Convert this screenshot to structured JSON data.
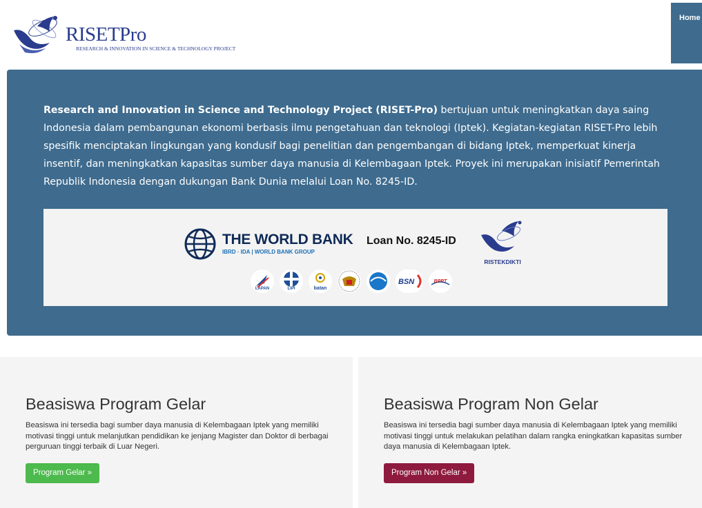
{
  "header": {
    "logo_title": "RISETPro",
    "logo_subtitle": "RESEARCH & INNOVATION IN SCIENCE & TECHNOLOGY PROJECT",
    "nav_home": "Home"
  },
  "hero": {
    "intro_bold": "Research and Innovation in Science and Technology Project (RISET-Pro)",
    "intro_rest": " bertujuan untuk meningkatkan daya saing Indonesia dalam pembangunan ekonomi berbasis ilmu pengetahuan dan teknologi (Iptek). Kegiatan-kegiatan RISET-Pro lebih spesifik menciptakan lingkungan yang kondusif bagi penelitian dan pengembangan di bidang Iptek, memperkuat kinerja insentif, dan meningkatkan kapasitas sumber daya manusia di Kelembagaan Iptek. Proyek ini merupakan inisiatif Pemerintah Republik Indonesia dengan dukungan Bank Dunia melalui Loan No. 8245-ID.",
    "banner": {
      "worldbank_title": "THE WORLD BANK",
      "worldbank_sub": "IBRD · IDA | WORLD BANK GROUP",
      "loan": "Loan No. 8245-ID",
      "ristek_label": "RISTEKDIKTI",
      "agency_logos": [
        {
          "name": "lapan",
          "caption": "LAPAN"
        },
        {
          "name": "lipi",
          "caption": "LIPI"
        },
        {
          "name": "batan",
          "caption": "batan"
        },
        {
          "name": "garuda",
          "caption": ""
        },
        {
          "name": "big",
          "caption": ""
        },
        {
          "name": "bsn",
          "caption": "BSN"
        },
        {
          "name": "bppt",
          "caption": "BPPT"
        }
      ]
    }
  },
  "cards": {
    "gelar": {
      "title": "Beasiswa Program Gelar",
      "text": "Beasiswa ini tersedia bagi sumber daya manusia di Kelembagaan Iptek yang memiliki motivasi tinggi untuk melanjutkan pendidikan ke jenjang Magister dan Doktor di berbagai perguruan tinggi terbaik di Luar Negeri.",
      "button": "Program Gelar »"
    },
    "non_gelar": {
      "title": "Beasiswa Program Non Gelar",
      "text": "Beasiswa ini tersedia bagi sumber daya manusia di Kelembagaan Iptek yang memiliki motivasi tinggi untuk melakukan pelatihan dalam rangka eningkatkan kapasitas sumber daya manusia di Kelembagaan Iptek.",
      "button": "Program Non Gelar »"
    }
  },
  "colors": {
    "primary": "#3e6b8e",
    "green_button": "#4cba4c",
    "maroon_button": "#8e1a3d",
    "logo_blue": "#2a3c8e"
  }
}
